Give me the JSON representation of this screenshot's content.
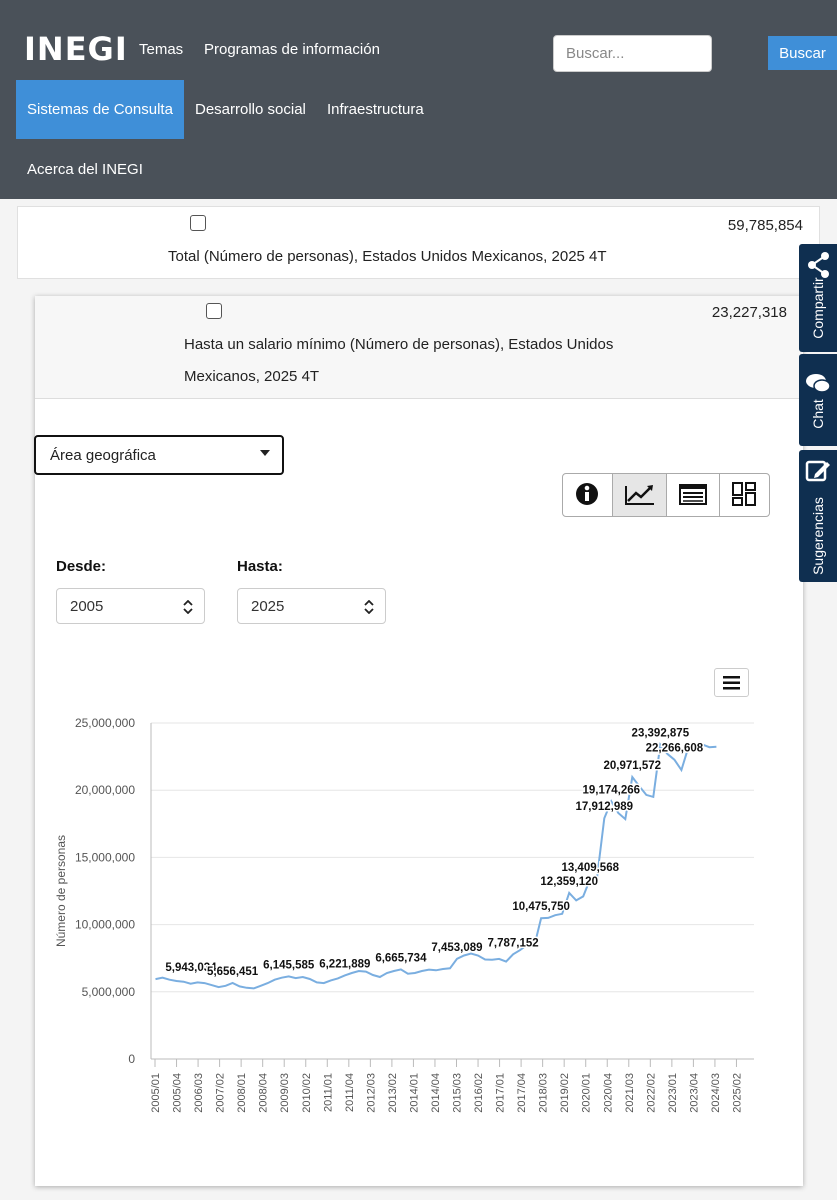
{
  "header": {
    "logo": "INEGI",
    "nav": [
      "Temas",
      "Programas de información",
      "Sistemas de Consulta",
      "Desarrollo social",
      "Infraestructura",
      "Acerca del INEGI"
    ],
    "active_nav": "Sistemas de Consulta",
    "search_placeholder": "Buscar...",
    "search_button": "Buscar"
  },
  "rows": [
    {
      "value": "59,785,854",
      "label": "Total (Número de personas), Estados Unidos Mexicanos, 2025 4T"
    },
    {
      "value": "23,227,318",
      "label_line1": "Hasta un salario mínimo (Número de personas), Estados Unidos",
      "label_line2": "Mexicanos, 2025 4T"
    }
  ],
  "controls": {
    "area_select": "Área geográfica",
    "from_label": "Desde:",
    "from_value": "2005",
    "to_label": "Hasta:",
    "to_value": "2025",
    "view_buttons": [
      "info-icon",
      "line-chart-icon",
      "table-icon",
      "dashboard-icon"
    ],
    "active_view": "line-chart-icon"
  },
  "side_tabs": [
    "Compartir",
    "Chat",
    "Sugerencias"
  ],
  "colors": {
    "header": "#4a5159",
    "accent": "#3f8fd8",
    "side_tab": "#0f2f50",
    "series": "#7aaee0"
  },
  "chart_data": {
    "type": "line",
    "ylabel": "Número de personas",
    "ylim": [
      0,
      25000000
    ],
    "yticks": [
      0,
      5000000,
      10000000,
      15000000,
      20000000,
      25000000
    ],
    "ytick_labels": [
      "0",
      "5,000,000",
      "10,000,000",
      "15,000,000",
      "20,000,000",
      "25,000,000"
    ],
    "xtick_labels": [
      "2005/01",
      "2005/04",
      "2006/03",
      "2007/02",
      "2008/01",
      "2008/04",
      "2009/03",
      "2010/02",
      "2011/01",
      "2011/04",
      "2012/03",
      "2013/02",
      "2014/01",
      "2014/04",
      "2015/03",
      "2016/02",
      "2017/01",
      "2017/04",
      "2018/03",
      "2019/02",
      "2020/01",
      "2020/04",
      "2021/03",
      "2022/02",
      "2023/01",
      "2023/04",
      "2024/03",
      "2025/02"
    ],
    "quarters_start": "2005/01",
    "values": [
      5943034,
      6050000,
      5900000,
      5800000,
      5750000,
      5600000,
      5700000,
      5650000,
      5500000,
      5350000,
      5450000,
      5656451,
      5400000,
      5300000,
      5250000,
      5450000,
      5650000,
      5900000,
      6050000,
      6145585,
      6020000,
      6100000,
      5950000,
      5700000,
      5650000,
      5850000,
      6000000,
      6221889,
      6400000,
      6550000,
      6500000,
      6250000,
      6100000,
      6400000,
      6550000,
      6665734,
      6350000,
      6400000,
      6550000,
      6650000,
      6600000,
      6700000,
      6750000,
      7453089,
      7700000,
      7850000,
      7700000,
      7400000,
      7380000,
      7450000,
      7250000,
      7787152,
      8100000,
      8500000,
      8350000,
      10475750,
      10500000,
      10700000,
      10800000,
      12359120,
      11800000,
      12100000,
      13409568,
      13600000,
      17912989,
      19174266,
      18300000,
      17850000,
      20971572,
      20300000,
      19650000,
      19500000,
      23392875,
      22700000,
      22266608,
      21500000,
      23200000,
      23350000,
      23400000,
      23200000,
      23227318
    ],
    "point_labels": [
      {
        "index": 0,
        "text": "5,943,034"
      },
      {
        "index": 11,
        "text": "5,656,451"
      },
      {
        "index": 19,
        "text": "6,145,585"
      },
      {
        "index": 27,
        "text": "6,221,889"
      },
      {
        "index": 35,
        "text": "6,665,734"
      },
      {
        "index": 43,
        "text": "7,453,089"
      },
      {
        "index": 51,
        "text": "7,787,152"
      },
      {
        "index": 55,
        "text": "10,475,750"
      },
      {
        "index": 59,
        "text": "12,359,120"
      },
      {
        "index": 62,
        "text": "13,409,568"
      },
      {
        "index": 64,
        "text": "17,912,989"
      },
      {
        "index": 65,
        "text": "19,174,266"
      },
      {
        "index": 68,
        "text": "20,971,572"
      },
      {
        "index": 72,
        "text": "23,392,875"
      },
      {
        "index": 74,
        "text": "22,266,608"
      }
    ]
  }
}
